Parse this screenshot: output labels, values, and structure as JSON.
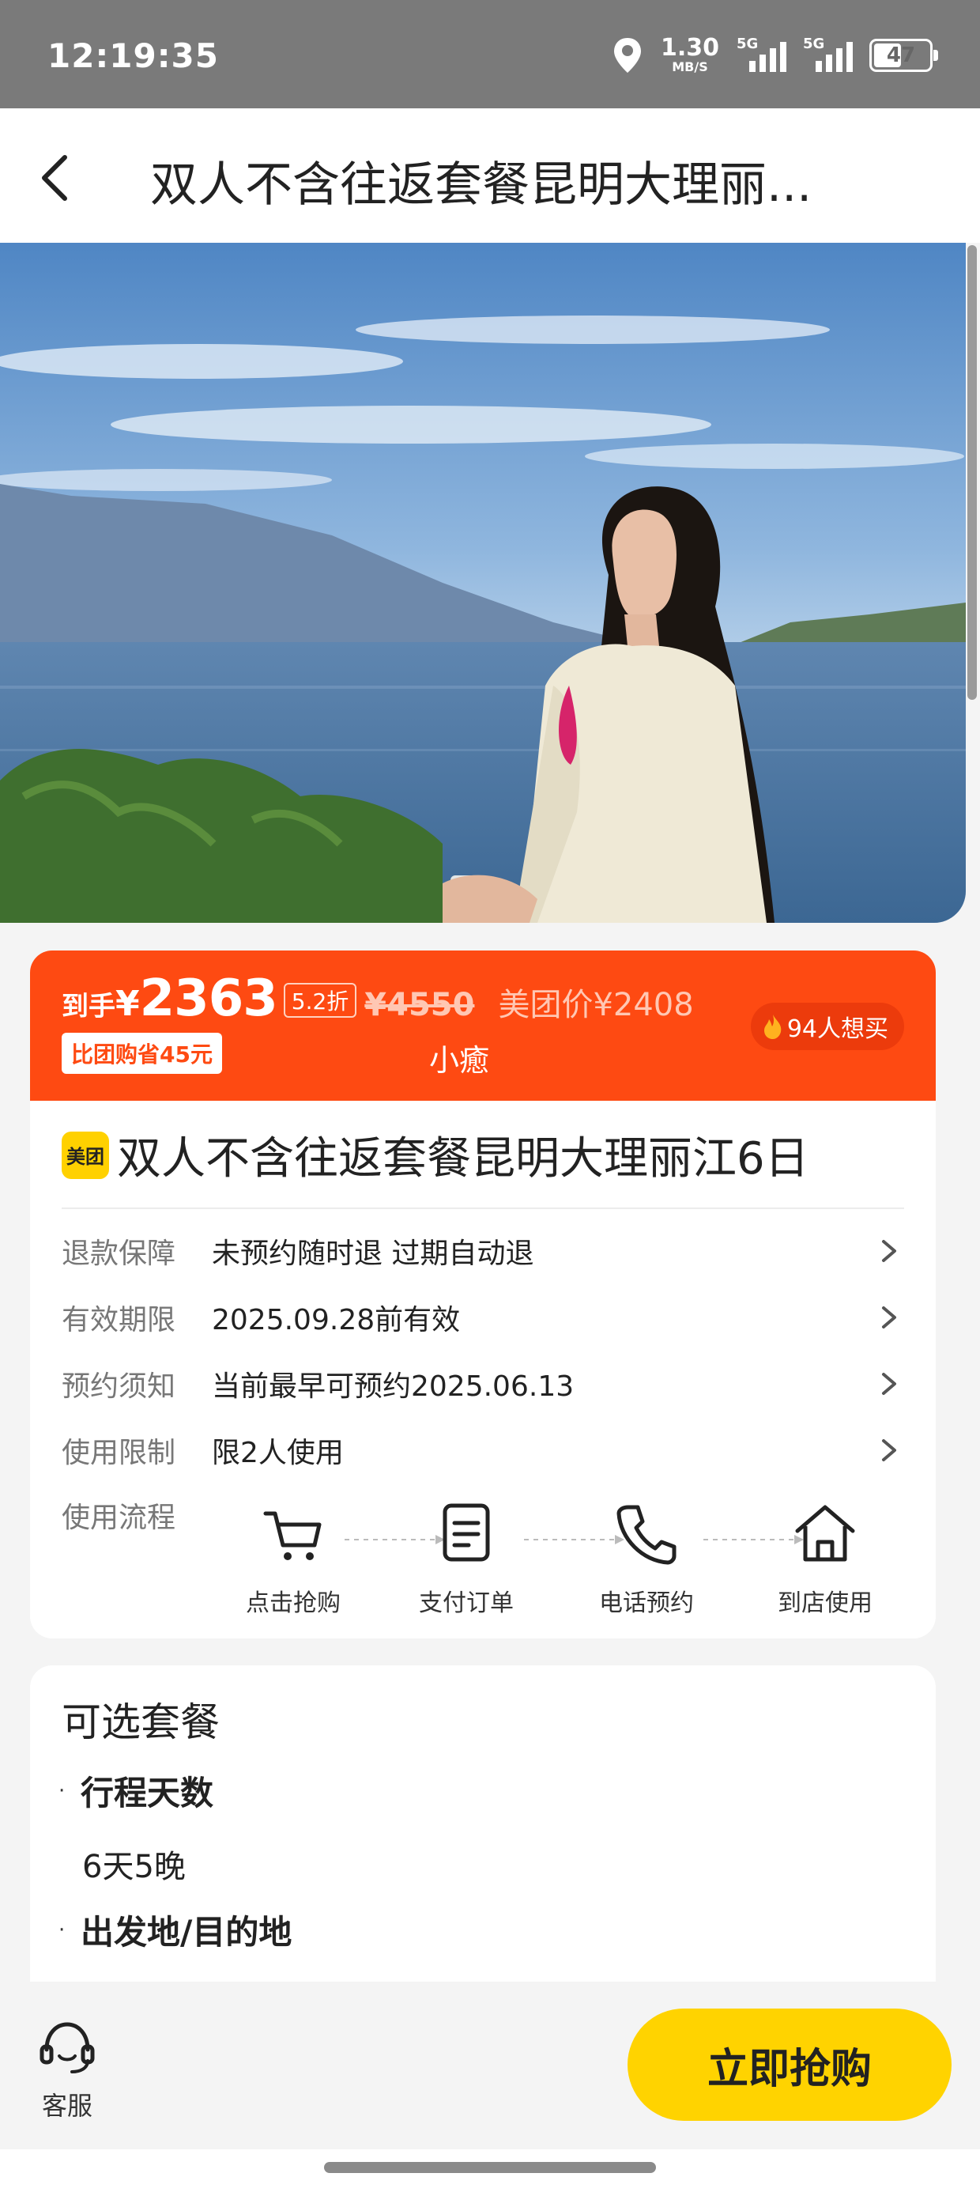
{
  "status": {
    "time": "12:19:35",
    "speed_value": "1.30",
    "speed_unit": "MB/S",
    "net1": "5G",
    "net2": "5G",
    "battery": "47"
  },
  "header": {
    "title": "双人不含往返套餐昆明大理丽..."
  },
  "price": {
    "to_hand_label": "到手",
    "currency": "¥",
    "amount": "2363",
    "discount": "5.2折",
    "original": "¥4550",
    "meituan_price": "美团价¥2408",
    "save_badge": "比团购省45元",
    "merchant": "小癒",
    "want": "94人想买"
  },
  "product": {
    "logo": "美团",
    "name": "双人不含往返套餐昆明大理丽江6日",
    "rows": [
      {
        "key": "退款保障",
        "value": "未预约随时退 过期自动退"
      },
      {
        "key": "有效期限",
        "value": "2025.09.28前有效"
      },
      {
        "key": "预约须知",
        "value": "当前最早可预约2025.06.13"
      },
      {
        "key": "使用限制",
        "value": "限2人使用"
      }
    ],
    "flow_label": "使用流程",
    "steps": [
      {
        "label": "点击抢购",
        "icon": "cart-icon"
      },
      {
        "label": "支付订单",
        "icon": "document-icon"
      },
      {
        "label": "电话预约",
        "icon": "phone-icon"
      },
      {
        "label": "到店使用",
        "icon": "store-icon"
      }
    ]
  },
  "packages": {
    "title": "可选套餐",
    "sections": [
      {
        "name": "行程天数",
        "value": "6天5晚"
      },
      {
        "name": "出发地/目的地",
        "value": ""
      }
    ]
  },
  "bottom": {
    "service_label": "客服",
    "buy_label": "立即抢购"
  },
  "colors": {
    "accent_orange": "#fe4a12",
    "buy_yellow": "#ffd300",
    "meituan_yellow": "#ffd100"
  }
}
